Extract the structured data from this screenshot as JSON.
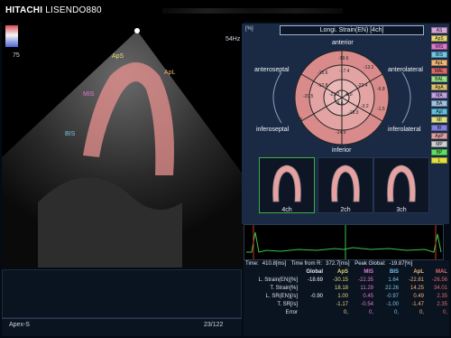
{
  "header": {
    "brand": "HITACHI",
    "model": "LISENDO880"
  },
  "ultrasound": {
    "frequency": "54Hz",
    "color_scale_value": "75",
    "segment_labels": [
      "ApS",
      "ApL",
      "MIS",
      "BIS"
    ],
    "view_name": "Apex-S",
    "frame_counter": "23/122"
  },
  "strain_panel": {
    "unit": "[%]",
    "title": "Longi. Strain(EN) [4ch]",
    "orientation": {
      "anterior": "anterior",
      "inferior": "inferior",
      "anteroseptal": "anteroseptal",
      "anterolateral": "anterolateral",
      "inferoseptal": "inferoseptal",
      "inferolateral": "inferolateral"
    },
    "bullseye_values": [
      "-19.6",
      "-13.2",
      "-17.4",
      "-15.6",
      "-12.8",
      "-21.2",
      "-6.8",
      "-22.4",
      "-3.6",
      "-1.5",
      "-20.5",
      "-18.3",
      "-6.8",
      "-3.2",
      "-14.9",
      "1.8"
    ],
    "views": [
      {
        "label": "4ch"
      },
      {
        "label": "2ch"
      },
      {
        "label": "3ch"
      }
    ],
    "legend": [
      {
        "name": "AS",
        "color": "#d9a6d9"
      },
      {
        "name": "ApS",
        "color": "#e6d873"
      },
      {
        "name": "MIS",
        "color": "#e07ad0"
      },
      {
        "name": "BIS",
        "color": "#72c6e6"
      },
      {
        "name": "ApL",
        "color": "#f2b573"
      },
      {
        "name": "MAL",
        "color": "#e06a6a"
      },
      {
        "name": "BAL",
        "color": "#9adf8a"
      },
      {
        "name": "ApA",
        "color": "#e0c070"
      },
      {
        "name": "MA",
        "color": "#c0a0e0"
      },
      {
        "name": "BA",
        "color": "#a0c0e0"
      },
      {
        "name": "ApI",
        "color": "#60c0e0"
      },
      {
        "name": "MI",
        "color": "#e0e080"
      },
      {
        "name": "BI",
        "color": "#8080e0"
      },
      {
        "name": "ApP",
        "color": "#e0a0a0"
      },
      {
        "name": "MP",
        "color": "#d0d0d0"
      },
      {
        "name": "BP",
        "color": "#60e060"
      },
      {
        "name": "L",
        "color": "#e0e040"
      }
    ]
  },
  "table": {
    "time_label": "Time:",
    "time_value": "410.8[ms]",
    "time_from_r_label": "Time from R:",
    "time_from_r_value": "372.7[ms]",
    "peak_global_label": "Peak Global:",
    "peak_global_value": "-19.87[%]",
    "columns": [
      "Global",
      "ApS",
      "MIS",
      "BIS",
      "ApL",
      "MAL"
    ],
    "column_colors": [
      "#e8eef5",
      "#e6d873",
      "#e07ad0",
      "#72c6e6",
      "#f2b573",
      "#e06a6a"
    ],
    "rows": [
      {
        "label": "L. Strain(EN)[%]",
        "values": [
          "-18.69",
          "-30.15",
          "-22.35",
          "1.64",
          "-22.81",
          "-26.56"
        ]
      },
      {
        "label": "T. Strain[%]",
        "values": [
          "",
          "18.18",
          "11.29",
          "22.26",
          "14.25",
          "34.01"
        ]
      },
      {
        "label": "L. SR(EN)[/s]",
        "values": [
          "-0.90",
          "1.00",
          "0.45",
          "-0.97",
          "0.49",
          "2.35"
        ]
      },
      {
        "label": "T. SR[/s]",
        "values": [
          "",
          "-1.17",
          "-0.54",
          "-1.00",
          "-1.47",
          "2.35"
        ]
      },
      {
        "label": "Error",
        "values": [
          "",
          "0,",
          "0,",
          "0,",
          "0,",
          "0,"
        ]
      }
    ]
  }
}
